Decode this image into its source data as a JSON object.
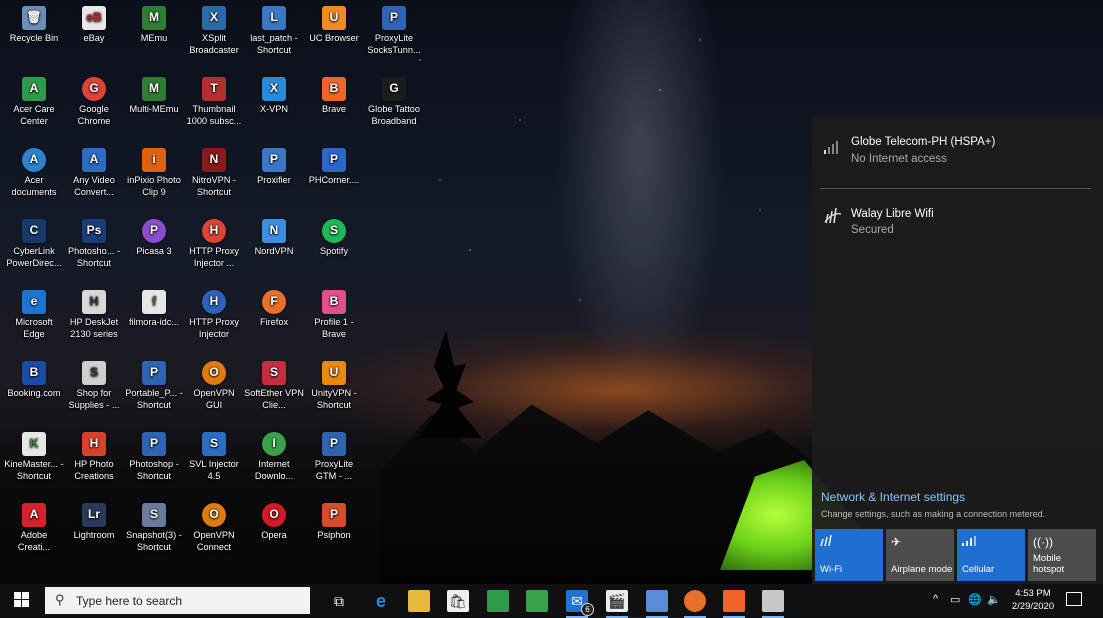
{
  "desktop": {
    "icons": [
      {
        "label": "Recycle Bin",
        "color": "#6b8fb8",
        "glyph": "🗑"
      },
      {
        "label": "eBay",
        "color": "#e8e8e8",
        "glyph": "eB"
      },
      {
        "label": "MEmu",
        "color": "#2e7d32",
        "glyph": "M"
      },
      {
        "label": "XSplit Broadcaster",
        "color": "#2a6aa8",
        "glyph": "X"
      },
      {
        "label": "last_patch - Shortcut",
        "color": "#3b78c4",
        "glyph": "L"
      },
      {
        "label": "UC Browser",
        "color": "#f08a24",
        "glyph": "U"
      },
      {
        "label": "ProxyLite SocksTunn...",
        "color": "#2f64b0",
        "glyph": "P"
      },
      {
        "label": "Acer Care Center",
        "color": "#2f9a4a",
        "glyph": "A"
      },
      {
        "label": "Google Chrome",
        "color": "#db4437",
        "glyph": "G"
      },
      {
        "label": "Multi-MEmu",
        "color": "#2e7d32",
        "glyph": "M"
      },
      {
        "label": "Thumbnail 1000 subsc...",
        "color": "#b03030",
        "glyph": "T"
      },
      {
        "label": "X-VPN",
        "color": "#2a8ad8",
        "glyph": "X"
      },
      {
        "label": "Brave",
        "color": "#f0642a",
        "glyph": "B"
      },
      {
        "label": "Globe Tattoo Broadband",
        "color": "#1c1c1c",
        "glyph": "G"
      },
      {
        "label": "Acer documents",
        "color": "#2c84d0",
        "glyph": "A"
      },
      {
        "label": "Any Video Convert...",
        "color": "#2b6cc4",
        "glyph": "A"
      },
      {
        "label": "inPixio Photo Clip 9",
        "color": "#e06010",
        "glyph": "i"
      },
      {
        "label": "NitroVPN - Shortcut",
        "color": "#8b1a1a",
        "glyph": "N"
      },
      {
        "label": "Proxifier",
        "color": "#3b78c4",
        "glyph": "P"
      },
      {
        "label": "PHCorner....",
        "color": "#2b66c8",
        "glyph": "P"
      },
      {
        "label": "CyberLink PowerDirec...",
        "color": "#183a6a",
        "glyph": "C"
      },
      {
        "label": "Photosho... - Shortcut",
        "color": "#1a3c7a",
        "glyph": "Ps"
      },
      {
        "label": "Picasa 3",
        "color": "#8a4fc8",
        "glyph": "P"
      },
      {
        "label": "HTTP Proxy Injector ...",
        "color": "#db4437",
        "glyph": "H"
      },
      {
        "label": "NordVPN",
        "color": "#3e8ee0",
        "glyph": "N"
      },
      {
        "label": "Spotify",
        "color": "#1db954",
        "glyph": "S"
      },
      {
        "label": "Microsoft Edge",
        "color": "#1e74d1",
        "glyph": "e"
      },
      {
        "label": "HP DeskJet 2130 series",
        "color": "#d8d8d8",
        "glyph": "H"
      },
      {
        "label": "filmora-idc...",
        "color": "#e6e6e6",
        "glyph": "f"
      },
      {
        "label": "HTTP Proxy Injector",
        "color": "#2d62b8",
        "glyph": "H"
      },
      {
        "label": "Firefox",
        "color": "#e8702a",
        "glyph": "F"
      },
      {
        "label": "Profile 1 - Brave",
        "color": "#e2508a",
        "glyph": "B"
      },
      {
        "label": "Booking.com",
        "color": "#1a4da2",
        "glyph": "B"
      },
      {
        "label": "Shop for Supplies - ...",
        "color": "#cfcfcf",
        "glyph": "S"
      },
      {
        "label": "Portable_P... - Shortcut",
        "color": "#2f64b0",
        "glyph": "P"
      },
      {
        "label": "OpenVPN GUI",
        "color": "#e07b10",
        "glyph": "O"
      },
      {
        "label": "SoftEther VPN Clie...",
        "color": "#c23040",
        "glyph": "S"
      },
      {
        "label": "UnityVPN - Shortcut",
        "color": "#e88a10",
        "glyph": "U"
      },
      {
        "label": "KineMaster... - Shortcut",
        "color": "#e6e6e6",
        "glyph": "K"
      },
      {
        "label": "HP Photo Creations",
        "color": "#d8402a",
        "glyph": "H"
      },
      {
        "label": "Photoshop - Shortcut",
        "color": "#2f64b0",
        "glyph": "P"
      },
      {
        "label": "SVL Injector 4.5",
        "color": "#2b6cc4",
        "glyph": "S"
      },
      {
        "label": "Internet Downlo...",
        "color": "#3aa04a",
        "glyph": "I"
      },
      {
        "label": "ProxyLite GTM - ...",
        "color": "#2f64b0",
        "glyph": "P"
      },
      {
        "label": "Adobe Creati...",
        "color": "#d8202a",
        "glyph": "A"
      },
      {
        "label": "Lightroom",
        "color": "#2a3a5a",
        "glyph": "Lr"
      },
      {
        "label": "Snapshot(3) - Shortcut",
        "color": "#6a7a9a",
        "glyph": "S"
      },
      {
        "label": "OpenVPN Connect",
        "color": "#e07b10",
        "glyph": "O"
      },
      {
        "label": "Opera",
        "color": "#d41a28",
        "glyph": "O"
      },
      {
        "label": "Psiphon",
        "color": "#d84a2a",
        "glyph": "P"
      }
    ]
  },
  "network_flyout": {
    "networks": [
      {
        "name": "Globe Telecom-PH (HSPA+)",
        "status": "No Internet access",
        "icon": "cellular-signal-icon"
      },
      {
        "name": "Walay Libre Wifi",
        "status": "Secured",
        "icon": "wifi-icon"
      }
    ],
    "settings_link": "Network & Internet settings",
    "settings_desc": "Change settings, such as making a connection metered.",
    "tiles": [
      {
        "label": "Wi-Fi",
        "state": "on",
        "icon": "wifi-icon"
      },
      {
        "label": "Airplane mode",
        "state": "off",
        "icon": "airplane-icon"
      },
      {
        "label": "Cellular",
        "state": "on",
        "icon": "cellular-icon"
      },
      {
        "label": "Mobile hotspot",
        "state": "off",
        "icon": "hotspot-icon"
      }
    ]
  },
  "taskbar": {
    "search_placeholder": "Type here to search",
    "mail_badge": "6",
    "clock_time": "4:53 PM",
    "clock_date": "2/29/2020"
  }
}
